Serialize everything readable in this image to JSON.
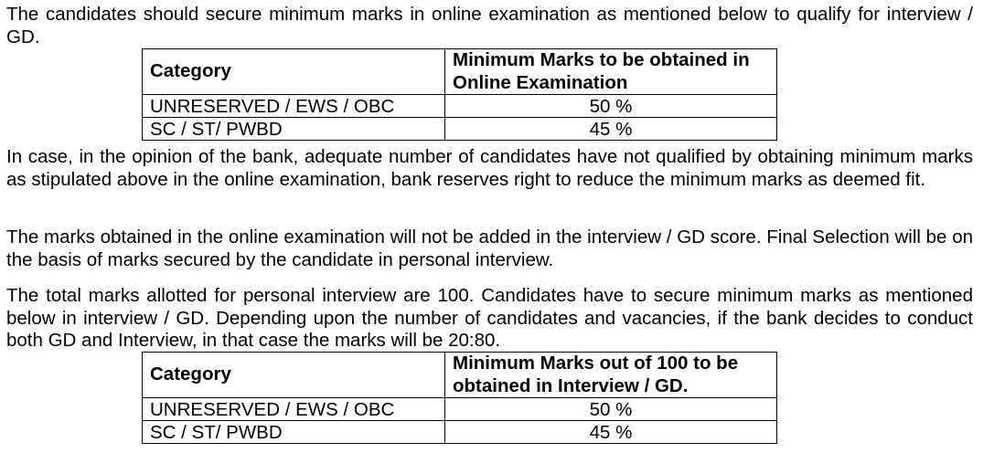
{
  "document": {
    "para1": "The candidates should secure minimum marks in online examination as mentioned below to qualify for interview / GD.",
    "table1": {
      "headers": [
        "Category",
        "Minimum Marks to be obtained in Online Examination"
      ],
      "rows": [
        [
          "UNRESERVED / EWS / OBC",
          "50 %"
        ],
        [
          "SC / ST/ PWBD",
          "45 %"
        ]
      ]
    },
    "para2": "In case, in the opinion of the bank, adequate number of candidates have not qualified by obtaining minimum marks as stipulated above in the online examination, bank reserves right to reduce the minimum marks as deemed fit.",
    "para3": "The marks obtained in the online examination will not be added in the interview / GD score. Final Selection will be on the basis of marks secured by the candidate in personal interview.",
    "para4": "The total marks allotted for personal interview are 100. Candidates have to secure minimum marks as mentioned below in interview / GD. Depending upon the number of candidates and vacancies, if the bank decides to conduct both GD and Interview, in that case the marks will be 20:80.",
    "table2": {
      "headers": [
        "Category",
        "Minimum Marks out of 100 to be obtained in Interview / GD."
      ],
      "rows": [
        [
          "UNRESERVED / EWS / OBC",
          "50 %"
        ],
        [
          "SC / ST/ PWBD",
          "45 %"
        ]
      ]
    }
  }
}
